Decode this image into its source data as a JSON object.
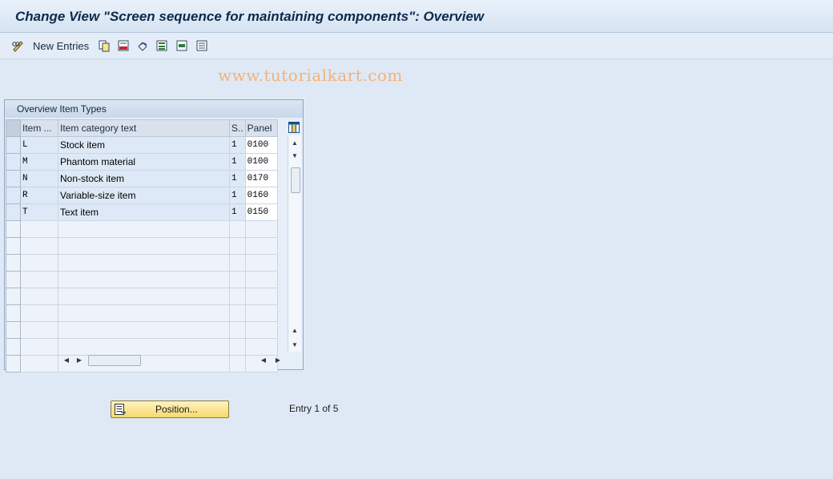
{
  "window": {
    "title": "Change View \"Screen sequence for maintaining components\": Overview"
  },
  "toolbar": {
    "new_entries_label": "New Entries",
    "icons": [
      "pencil-glasses-icon",
      "copy-icon",
      "delete-icon",
      "undo-icon",
      "select-all-icon",
      "select-block-icon",
      "deselect-all-icon"
    ]
  },
  "watermark": "www.tutorialkart.com",
  "table": {
    "title": "Overview Item Types",
    "columns": [
      "Item ...",
      "Item category text",
      "S..",
      "Panel"
    ],
    "rows": [
      {
        "item": "L",
        "text": "Stock item",
        "seq": "1",
        "panel": "0100"
      },
      {
        "item": "M",
        "text": "Phantom material",
        "seq": "1",
        "panel": "0100"
      },
      {
        "item": "N",
        "text": "Non-stock item",
        "seq": "1",
        "panel": "0170"
      },
      {
        "item": "R",
        "text": "Variable-size item",
        "seq": "1",
        "panel": "0160"
      },
      {
        "item": "T",
        "text": "Text item",
        "seq": "1",
        "panel": "0150"
      }
    ],
    "empty_rows": 8
  },
  "position_button": {
    "label": "Position..."
  },
  "entry_status": "Entry 1 of 5"
}
